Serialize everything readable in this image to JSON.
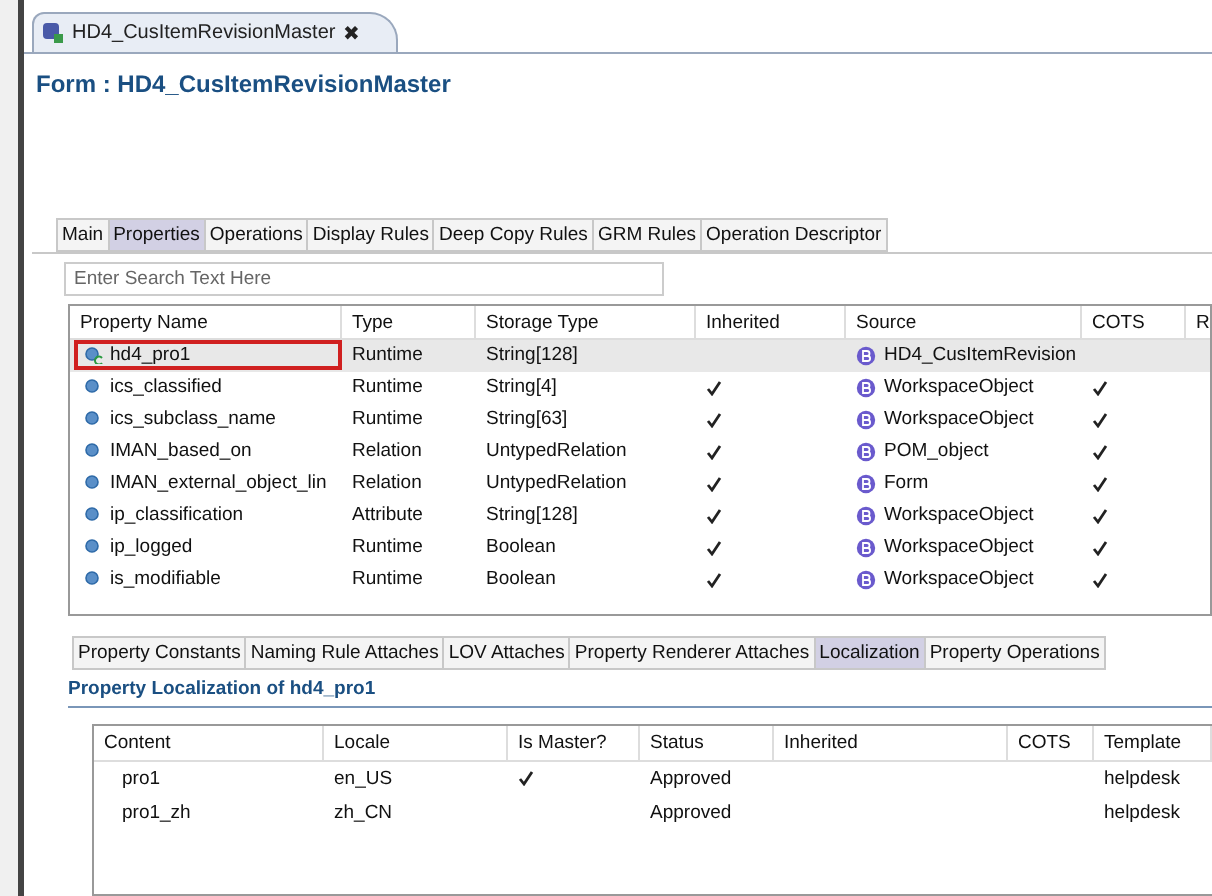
{
  "editor_tab": {
    "title": "HD4_CusItemRevisionMaster",
    "close": "✖"
  },
  "form_title": "Form : HD4_CusItemRevisionMaster",
  "tabs": [
    {
      "label": "Main",
      "selected": false
    },
    {
      "label": "Properties",
      "selected": true
    },
    {
      "label": "Operations",
      "selected": false
    },
    {
      "label": "Display Rules",
      "selected": false
    },
    {
      "label": "Deep Copy Rules",
      "selected": false
    },
    {
      "label": "GRM Rules",
      "selected": false
    },
    {
      "label": "Operation Descriptor",
      "selected": false
    }
  ],
  "search": {
    "placeholder": "Enter Search Text Here"
  },
  "properties_table": {
    "columns": [
      "Property Name",
      "Type",
      "Storage Type",
      "Inherited",
      "Source",
      "COTS",
      "R"
    ],
    "rows": [
      {
        "name": "hd4_pro1",
        "type": "Runtime",
        "storage": "String[128]",
        "inherited": false,
        "source": "HD4_CusItemRevision",
        "cots": false,
        "selected": true,
        "custom": true
      },
      {
        "name": "ics_classified",
        "type": "Runtime",
        "storage": "String[4]",
        "inherited": true,
        "source": "WorkspaceObject",
        "cots": true,
        "selected": false,
        "custom": false
      },
      {
        "name": "ics_subclass_name",
        "type": "Runtime",
        "storage": "String[63]",
        "inherited": true,
        "source": "WorkspaceObject",
        "cots": true,
        "selected": false,
        "custom": false
      },
      {
        "name": "IMAN_based_on",
        "type": "Relation",
        "storage": "UntypedRelation",
        "inherited": true,
        "source": "POM_object",
        "cots": true,
        "selected": false,
        "custom": false
      },
      {
        "name": "IMAN_external_object_lin",
        "type": "Relation",
        "storage": "UntypedRelation",
        "inherited": true,
        "source": "Form",
        "cots": true,
        "selected": false,
        "custom": false
      },
      {
        "name": "ip_classification",
        "type": "Attribute",
        "storage": "String[128]",
        "inherited": true,
        "source": "WorkspaceObject",
        "cots": true,
        "selected": false,
        "custom": false
      },
      {
        "name": "ip_logged",
        "type": "Runtime",
        "storage": "Boolean",
        "inherited": true,
        "source": "WorkspaceObject",
        "cots": true,
        "selected": false,
        "custom": false
      },
      {
        "name": "is_modifiable",
        "type": "Runtime",
        "storage": "Boolean",
        "inherited": true,
        "source": "WorkspaceObject",
        "cots": true,
        "selected": false,
        "custom": false
      }
    ]
  },
  "bottom_tabs": [
    {
      "label": "Property Constants",
      "selected": false
    },
    {
      "label": "Naming Rule Attaches",
      "selected": false
    },
    {
      "label": "LOV Attaches",
      "selected": false
    },
    {
      "label": "Property Renderer Attaches",
      "selected": false
    },
    {
      "label": "Localization",
      "selected": true
    },
    {
      "label": "Property Operations",
      "selected": false
    }
  ],
  "localization": {
    "title": "Property Localization of hd4_pro1",
    "columns": [
      "Content",
      "Locale",
      "Is Master?",
      "Status",
      "Inherited",
      "COTS",
      "Template"
    ],
    "rows": [
      {
        "content": "pro1",
        "locale": "en_US",
        "master": true,
        "status": "Approved",
        "template": "helpdesk"
      },
      {
        "content": "pro1_zh",
        "locale": "zh_CN",
        "master": false,
        "status": "Approved",
        "template": "helpdesk"
      }
    ]
  }
}
